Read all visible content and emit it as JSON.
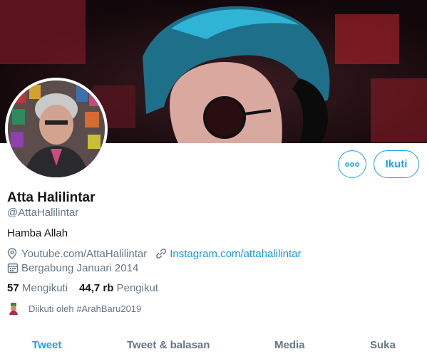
{
  "profile": {
    "name": "Atta Halilintar",
    "handle": "@AttaHalilintar",
    "bio": "Hamba Allah",
    "link_youtube": "Youtube.com/AttaHalilintar",
    "link_instagram": "Instagram.com/attahalilintar",
    "joined": "Bergabung Januari 2014"
  },
  "actions": {
    "more_label": "◦◦◦",
    "follow_label": "Ikuti"
  },
  "stats": {
    "following_count": "57",
    "following_label": "Mengikuti",
    "followers_count": "44,7 rb",
    "followers_label": "Pengikut"
  },
  "followed_by": "Diikuti oleh #ArahBaru2019",
  "tabs": [
    {
      "label": "Tweet",
      "active": true
    },
    {
      "label": "Tweet & balasan",
      "active": false
    },
    {
      "label": "Media",
      "active": false
    },
    {
      "label": "Suka",
      "active": false
    }
  ],
  "colors": {
    "accent": "#1da1f2",
    "link": "#1b95e0",
    "muted": "#657786",
    "text": "#14171a"
  },
  "icons": {
    "location": "location-pin-icon",
    "link": "link-icon",
    "calendar": "calendar-icon"
  }
}
